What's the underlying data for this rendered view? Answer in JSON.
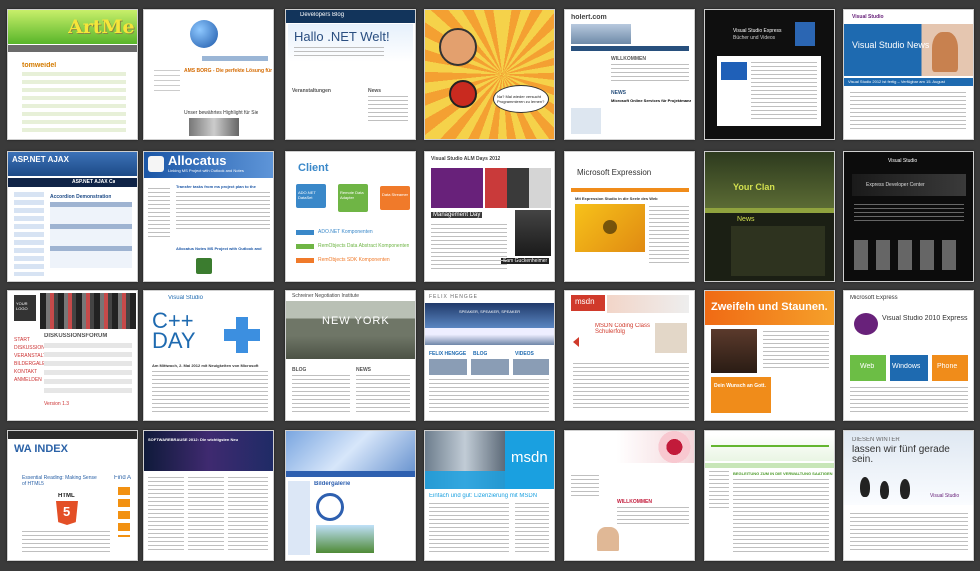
{
  "tiles": {
    "r1c1": {
      "banner": "ArtMe!",
      "heading": "tomweidel"
    },
    "r1c2": {
      "title": "AMS BORG - Die perfekte Lösung für D",
      "subtitle": "Unser bewährtes Highlight für Sie"
    },
    "r1c3": {
      "brand": "Developers Blog",
      "title": "Hallo .NET Welt!",
      "section": "Veranstaltungen",
      "news": "News"
    },
    "r1c4": {
      "bubble": "Na? Mal wieder versucht Programmieren zu lernen?"
    },
    "r1c5": {
      "brand": "holert.com",
      "welcome": "WILLKOMMEN",
      "news": "NEWS",
      "headline": "Microsoft Online Services für Projektmanagement"
    },
    "r1c6": {
      "title": "Visual Studio Express",
      "subtitle": "Bücher und Videos"
    },
    "r1c7": {
      "brand": "Visual Studio",
      "title": "Visual Studio News",
      "bar": "Visual Studio 2012 ist fertig – Verfügbar am 15. August"
    },
    "r2c1": {
      "brand": "ASP.NET AJAX",
      "sub": "ASP.NET AJAX Ca",
      "heading": "Accordion Demonstration"
    },
    "r2c2": {
      "title": "Allocatus",
      "subtitle": "Linking MS Project with Outlook and Notes",
      "text": "Transfer tasks from ms project plan to the",
      "link": "Allocatus Notes MS Project with Outlook and"
    },
    "r2c3": {
      "client": "Client",
      "box1": "ADO.NET DataSet",
      "box2": "Remote Data Adapter",
      "box3": "Data Streamer",
      "l1": "ADO.NET Komponenten",
      "l2": "RemObjects Data Abstract Komponenten",
      "l3": "RemObjects SDK Komponenten"
    },
    "r2c4": {
      "brand": "Visual Studio ALM Days 2012",
      "heading": "Management Day",
      "speaker": "Sam Guckenheimer"
    },
    "r2c5": {
      "brand": "Microsoft Expression",
      "heading": "Mit Expression Studio in die Seele des Web"
    },
    "r2c6": {
      "title": "Your Clan",
      "news": "News"
    },
    "r2c7": {
      "brand": "Visual Studio",
      "bar": "Express Developer Center"
    },
    "r3c1": {
      "brand": "YOUR LOGO",
      "forum": "DISKUSSIONSFORUM",
      "nav": [
        "START",
        "DISKUSSIONSFORUM",
        "VERANSTALTUNGEN",
        "BILDERGALERIE",
        "KONTAKT",
        "ANMELDEN"
      ],
      "ver": "Version 1.3"
    },
    "r3c2": {
      "brand": "Visual Studio",
      "title": "C++ DAY",
      "heading": "Am Mittwoch, 2. Mai 2012 mit Neuigkeiten von Microsoft"
    },
    "r3c3": {
      "brand": "Schreiner Negotiation Institute",
      "hero": "NEW YORK",
      "blog": "BLOG",
      "news": "NEWS"
    },
    "r3c4": {
      "brand": "FELIX HENGGE",
      "hero": "SPEAKER, SPEAKER, SPEAKER",
      "col1": "FELIX HENGGE",
      "col2": "BLOG",
      "col3": "VIDEOS"
    },
    "r3c5": {
      "brand": "msdn",
      "title": "MSDN Coding Class Schulerfolg"
    },
    "r3c6": {
      "title": "Zweifeln und Staunen.",
      "sub": "Dein Wunsch an Gott."
    },
    "r3c7": {
      "brand": "Microsoft Express",
      "title": "Visual Studio 2010 Express",
      "tab1": "Web",
      "tab2": "Windows",
      "tab3": "Phone"
    },
    "r4c1": {
      "brand": "WA INDEX",
      "title": "Essential Reading: Making Sense of HTML5",
      "badge": "HTML",
      "five": "5",
      "side": "Find A"
    },
    "r4c2": {
      "headline": "SOFTWAREBRAUSE 2012: Die wichtigsten Neuheiten"
    },
    "r4c3": {
      "title": "Bildergalerie"
    },
    "r4c4": {
      "msdn": "msdn",
      "headline": "Einfach und gut: Lizenzierung mit MSDN"
    },
    "r4c5": {
      "welcome": "WILLKOMMEN"
    },
    "r4c6": {
      "heading": "BEGLEITUNG ZUM IN DIE VERWALTUNG SAATIGEN"
    },
    "r4c7": {
      "line1": "DIESEN WINTER",
      "line2": "lassen wir fünf gerade sein.",
      "brand": "Visual Studio"
    }
  },
  "colors": {
    "background": "#3a3a3a",
    "msBlue": "#1e6ab0",
    "vsPurple": "#68217a",
    "orange": "#f08c1a",
    "green": "#64b630"
  }
}
